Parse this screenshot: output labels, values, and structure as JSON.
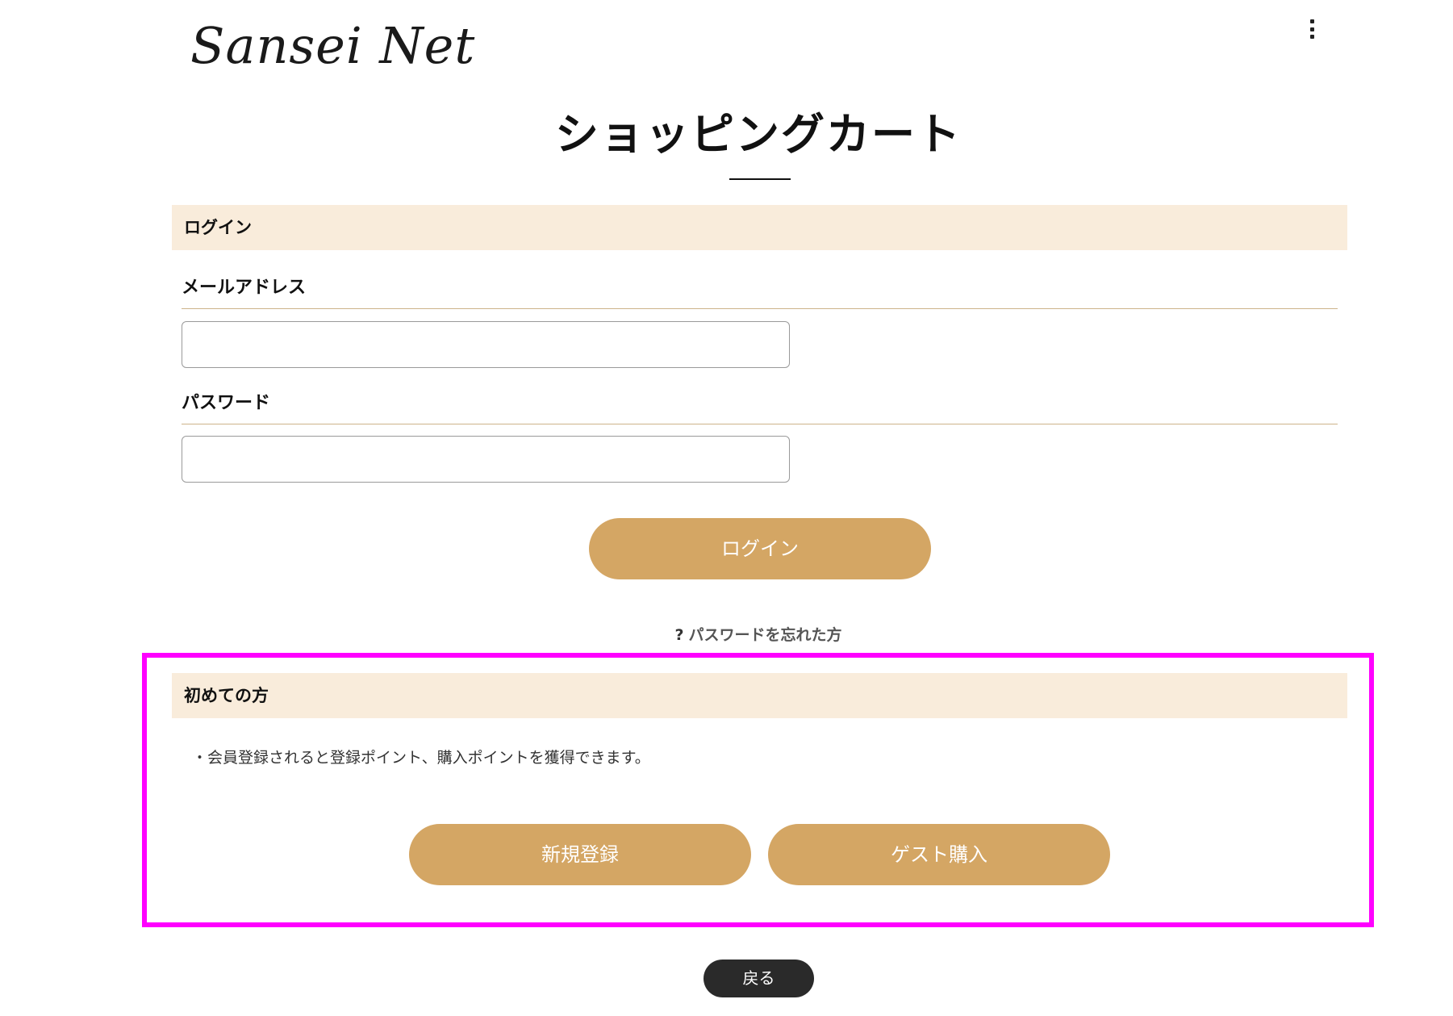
{
  "header": {
    "logo_text": "Sansei Net",
    "menu_icon": "kebab-menu-icon"
  },
  "page_title": "ショッピングカート",
  "login_section": {
    "heading": "ログイン",
    "email_label": "メールアドレス",
    "email_value": "",
    "email_placeholder": "",
    "password_label": "パスワード",
    "password_value": "",
    "password_placeholder": "",
    "login_button": "ログイン",
    "forgot_icon": "?",
    "forgot_link": "パスワードを忘れた方"
  },
  "new_customer_section": {
    "heading": "初めての方",
    "bullet_text": "・会員登録されると登録ポイント、購入ポイントを獲得できます。",
    "register_button": "新規登録",
    "guest_button": "ゲスト購入"
  },
  "back_button": "戻る",
  "colors": {
    "accent": "#d4a664",
    "section_bg": "#f9ecdb",
    "highlight_border": "#ff00ff",
    "back_button_bg": "#2a2a2a"
  }
}
